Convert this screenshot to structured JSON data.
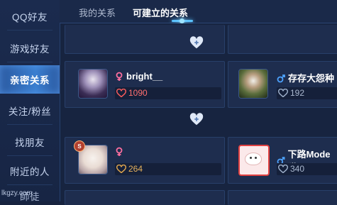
{
  "sidebar": {
    "items": [
      {
        "label": "QQ好友",
        "active": false
      },
      {
        "label": "游戏好友",
        "active": false
      },
      {
        "label": "亲密关系",
        "active": true
      },
      {
        "label": "关注/粉丝",
        "active": false
      },
      {
        "label": "找朋友",
        "active": false
      },
      {
        "label": "附近的人",
        "active": false
      },
      {
        "label": "師徒",
        "active": false
      }
    ]
  },
  "tabs": [
    {
      "label": "我的关系",
      "active": false
    },
    {
      "label": "可建立的关系",
      "active": true
    }
  ],
  "cards": [
    {
      "name": "bright__",
      "gender": "female",
      "intimacy": "1090",
      "heart_color": "red"
    },
    {
      "name": "存存大怨种",
      "gender": "male",
      "intimacy": "192",
      "heart_color": "gray"
    },
    {
      "name": "",
      "gender": "female",
      "intimacy": "264",
      "heart_color": "gold",
      "badge": "S"
    },
    {
      "name": "下路Mode猫",
      "gender": "male",
      "intimacy": "340",
      "heart_color": "gray"
    }
  ],
  "watermark": "lkgzy.com",
  "colors": {
    "active_nav": "#3b7fd0",
    "female": "#ff6fa0",
    "male": "#4da3ff",
    "intimacy_red": "#ff6f6f",
    "intimacy_gold": "#e5b15c"
  }
}
